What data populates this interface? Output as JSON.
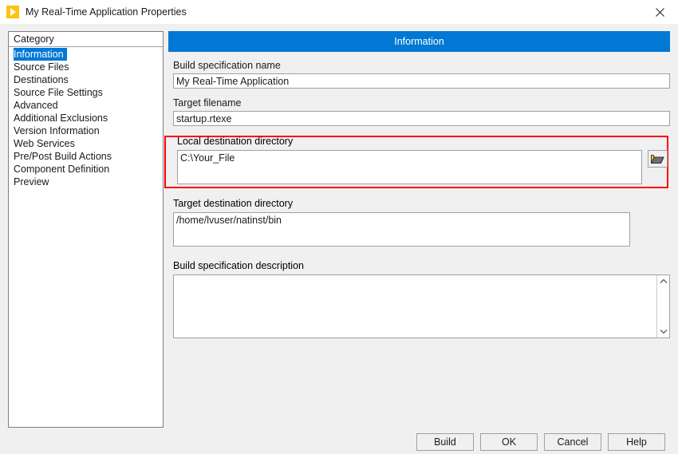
{
  "window": {
    "title": "My Real-Time Application Properties",
    "app_icon": "labview-run-arrow-icon",
    "close_label": "close-icon"
  },
  "sidebar": {
    "header": "Category",
    "items": [
      {
        "label": "Information",
        "selected": true
      },
      {
        "label": "Source Files",
        "selected": false
      },
      {
        "label": "Destinations",
        "selected": false
      },
      {
        "label": "Source File Settings",
        "selected": false
      },
      {
        "label": "Advanced",
        "selected": false
      },
      {
        "label": "Additional Exclusions",
        "selected": false
      },
      {
        "label": "Version Information",
        "selected": false
      },
      {
        "label": "Web Services",
        "selected": false
      },
      {
        "label": "Pre/Post Build Actions",
        "selected": false
      },
      {
        "label": "Component Definition",
        "selected": false
      },
      {
        "label": "Preview",
        "selected": false
      }
    ]
  },
  "main": {
    "panel_title": "Information",
    "build_spec_name": {
      "label": "Build specification name",
      "value": "My Real-Time Application",
      "placeholder": ""
    },
    "target_filename": {
      "label": "Target filename",
      "value": "startup.rtexe",
      "placeholder": ""
    },
    "local_destination_directory": {
      "label": "Local destination directory",
      "value": "C:\\Your_File",
      "placeholder": "",
      "browse_icon": "open-folder-icon",
      "highlighted": true,
      "highlight_color": "#ff0000"
    },
    "target_destination_directory": {
      "label": "Target destination directory",
      "value": "/home/lvuser/natinst/bin",
      "placeholder": ""
    },
    "build_spec_description": {
      "label": "Build specification description",
      "value": "",
      "placeholder": "",
      "scroll_up_icon": "chevron-up-icon",
      "scroll_down_icon": "chevron-down-icon"
    }
  },
  "footer": {
    "buttons": [
      {
        "label": "Build"
      },
      {
        "label": "OK"
      },
      {
        "label": "Cancel"
      },
      {
        "label": "Help"
      }
    ]
  },
  "colors": {
    "panel_header_blue": "#0078d4",
    "selection_blue": "#0078d7",
    "highlight_red": "#ff0000",
    "dialog_background": "#f0f0f0",
    "icon_yellow": "#ffc20e"
  }
}
